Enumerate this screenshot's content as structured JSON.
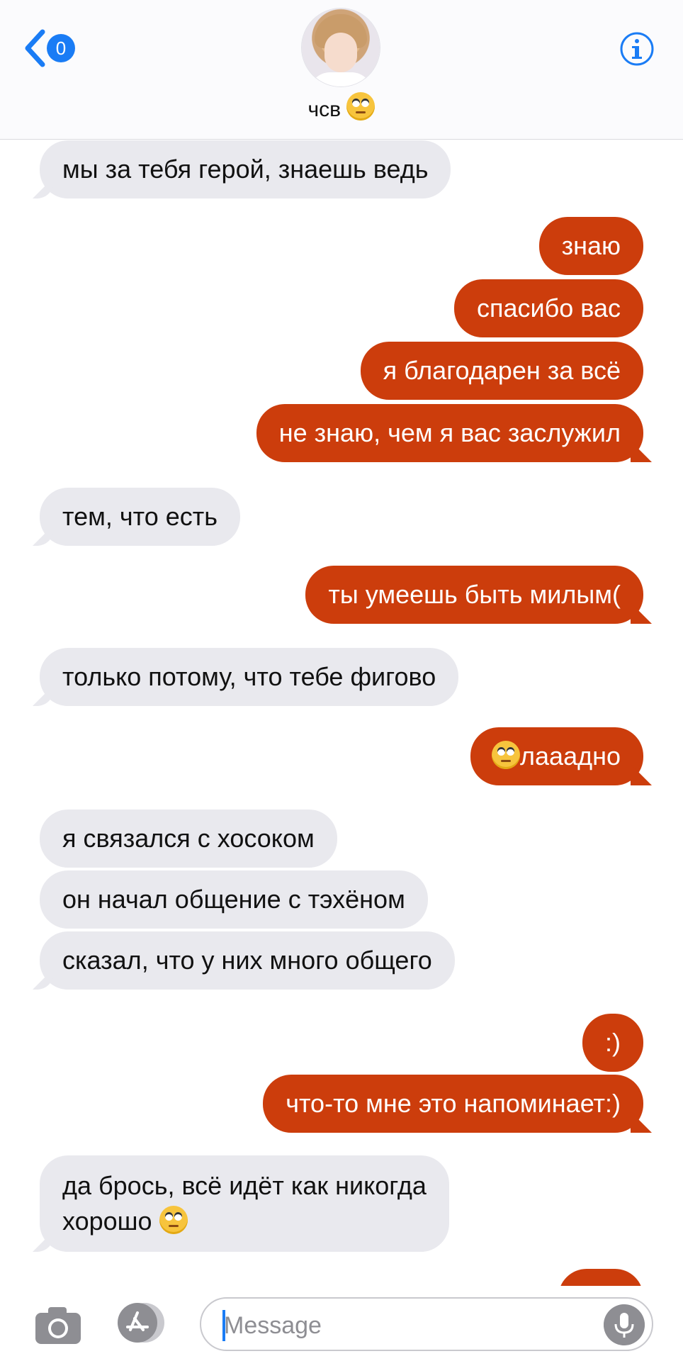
{
  "header": {
    "back_badge": "0",
    "contact_name": "чсв",
    "avatar_icon": "contact-avatar-photo",
    "info_icon": "info-icon"
  },
  "colors": {
    "accent": "#1a7cf5",
    "incoming_bubble": "#e9e9ee",
    "outgoing_bubble": "#cc3d0c"
  },
  "messages": [
    {
      "side": "in",
      "text": "мы за тебя герой, знаешь ведь"
    },
    {
      "side": "out",
      "text": "знаю"
    },
    {
      "side": "out",
      "text": "спасибо вас"
    },
    {
      "side": "out",
      "text": "я благодарен за всё"
    },
    {
      "side": "out",
      "text": "не знаю, чем я вас заслужил"
    },
    {
      "side": "in",
      "text": "тем, что есть"
    },
    {
      "side": "out",
      "text": "ты умеешь быть милым("
    },
    {
      "side": "in",
      "text": "только потому, что тебе фигово"
    },
    {
      "side": "out",
      "text": "лааадно",
      "emoji_before": "face-with-rolling-eyes"
    },
    {
      "side": "in",
      "text": "я связался с хосоком"
    },
    {
      "side": "in",
      "text": "он начал общение с тэхёном"
    },
    {
      "side": "in",
      "text": "сказал, что у них много общего"
    },
    {
      "side": "out",
      "text": ":)"
    },
    {
      "side": "out",
      "text": "что-то мне это напоминает:)"
    },
    {
      "side": "in",
      "line1": "да брось, всё идёт как никогда",
      "line2": "хорошо",
      "emoji_after": "face-with-rolling-eyes"
    }
  ],
  "composer": {
    "placeholder": "Message",
    "camera_icon": "camera-icon",
    "apps_icon": "app-store-icon",
    "mic_icon": "microphone-icon"
  }
}
